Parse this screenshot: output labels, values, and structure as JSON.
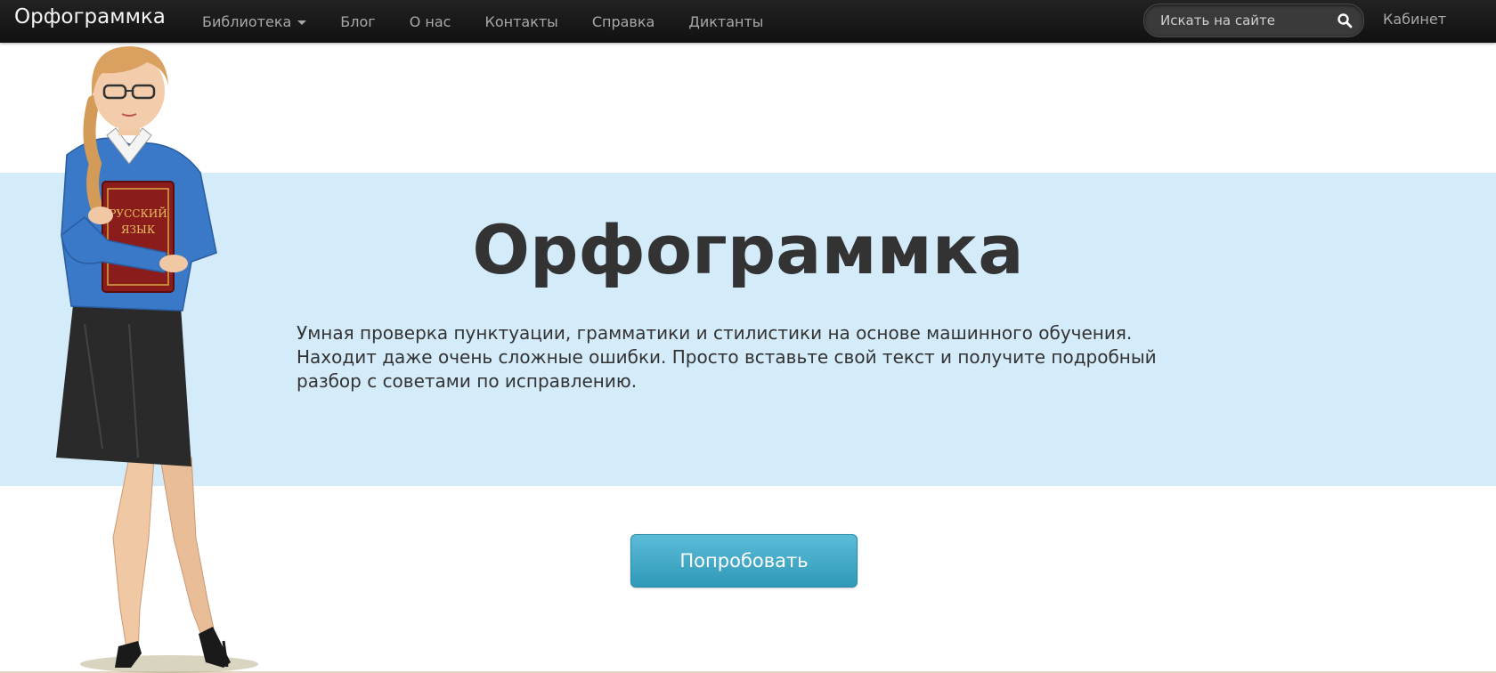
{
  "navbar": {
    "brand": "Орфограммка",
    "items": [
      {
        "label": "Библиотека",
        "dropdown": true
      },
      {
        "label": "Блог"
      },
      {
        "label": "О нас"
      },
      {
        "label": "Контакты"
      },
      {
        "label": "Справка"
      },
      {
        "label": "Диктанты"
      }
    ],
    "search": {
      "placeholder": "Искать на сайте",
      "icon": "search-icon"
    },
    "cabinet": "Кабинет"
  },
  "hero": {
    "title": "Орфограммка",
    "lines": [
      "Умная проверка пунктуации, грамматики и стилистики на основе машинного обучения.",
      "Находит даже очень сложные ошибки. Просто вставьте свой текст и получите подробный",
      "разбор с советами по исправлению."
    ],
    "button": "Попробовать"
  },
  "mascot": {
    "book_lines": [
      "РУССКИЙ",
      "ЯЗЫК"
    ]
  },
  "colors": {
    "navbar": "#1a1a1a",
    "band": "#d4ebfa",
    "button": "#3ba7c6",
    "text": "#333333"
  }
}
